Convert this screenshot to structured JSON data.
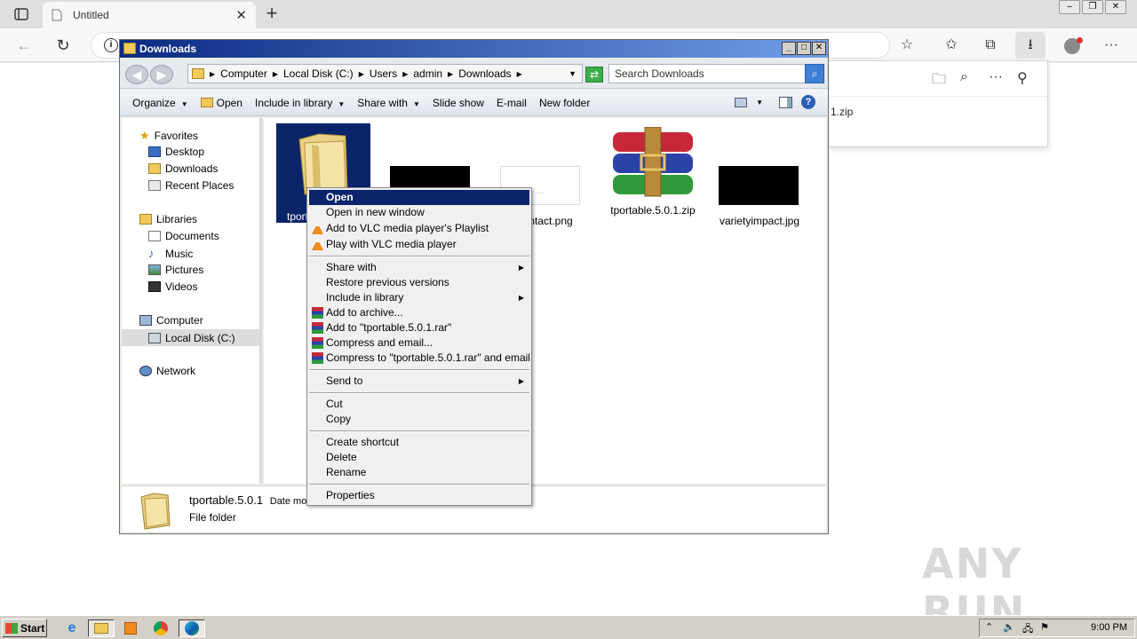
{
  "browser": {
    "tab_title": "Untitled",
    "downloads_panel": {
      "file_fragment": "1.zip"
    },
    "watermark": "ANY RUN"
  },
  "explorer": {
    "title": "Downloads",
    "breadcrumb": [
      "Computer",
      "Local Disk (C:)",
      "Users",
      "admin",
      "Downloads"
    ],
    "search_placeholder": "Search Downloads",
    "commands": [
      {
        "label": "Organize",
        "dropdown": true
      },
      {
        "label": "Open",
        "dropdown": false
      },
      {
        "label": "Include in library",
        "dropdown": true
      },
      {
        "label": "Share with",
        "dropdown": true
      },
      {
        "label": "Slide show",
        "dropdown": false
      },
      {
        "label": "E-mail",
        "dropdown": false
      },
      {
        "label": "New folder",
        "dropdown": false
      }
    ],
    "nav": {
      "favorites": "Favorites",
      "desktop": "Desktop",
      "downloads": "Downloads",
      "recent": "Recent Places",
      "libraries": "Libraries",
      "documents": "Documents",
      "music": "Music",
      "pictures": "Pictures",
      "videos": "Videos",
      "computer": "Computer",
      "local_disk": "Local Disk (C:)",
      "network": "Network"
    },
    "files": [
      {
        "name": "tport",
        "type": "folder",
        "selected": true
      },
      {
        "name": "",
        "type": "image-black"
      },
      {
        "name": "ntact.png",
        "type": "image-white"
      },
      {
        "name": "tportable.5.0.1.zip",
        "type": "winrar"
      },
      {
        "name": "varietyimpact.jpg",
        "type": "image-black"
      }
    ],
    "details": {
      "name": "tportable.5.0.1",
      "date_fragment": "Date moc",
      "type": "File folder"
    }
  },
  "context_menu": {
    "items": {
      "open": "Open",
      "open_new_window": "Open in new window",
      "vlc_playlist": "Add to VLC media player's Playlist",
      "vlc_play": "Play with VLC media player",
      "share_with": "Share with",
      "restore": "Restore previous versions",
      "include_library": "Include in library",
      "add_archive": "Add to archive...",
      "add_rar": "Add to \"tportable.5.0.1.rar\"",
      "compress_email": "Compress and email...",
      "compress_rar_email": "Compress to \"tportable.5.0.1.rar\" and email",
      "send_to": "Send to",
      "cut": "Cut",
      "copy": "Copy",
      "create_shortcut": "Create shortcut",
      "delete": "Delete",
      "rename": "Rename",
      "properties": "Properties"
    }
  },
  "taskbar": {
    "start": "Start",
    "clock": "9:00 PM"
  },
  "colors": {
    "selection": "#0a246a",
    "title_gradient_start": "#0b2a82",
    "title_gradient_end": "#6f9ee8"
  }
}
